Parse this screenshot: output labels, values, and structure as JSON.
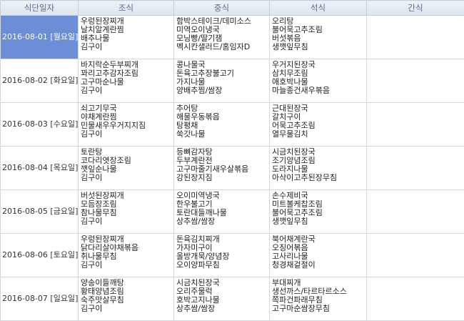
{
  "headers": [
    "식단일자",
    "조식",
    "중식",
    "석식",
    "간식"
  ],
  "rows": [
    {
      "date": "2016-08-01 [월요일]",
      "breakfast": [
        "우렁된장찌개",
        "날치알계란찜",
        "배추나물",
        "김구이"
      ],
      "lunch": [
        "함박스테이크/데미소스",
        "미역오이냉국",
        "모닝빵/딸기잼",
        "멕시칸샐러드/홈임자D"
      ],
      "dinner": [
        "오리탕",
        "불어묵고추조림",
        "버섯볶음",
        "생깻잎무침"
      ],
      "snack": []
    },
    {
      "date": "2016-08-02 [화요일]",
      "breakfast": [
        "바지락순두부찌개",
        "꽈리고추감자조림",
        "고구마순나물",
        "김구이"
      ],
      "lunch": [
        "콩나물국",
        "돈육고추장불고기",
        "가지나물",
        "양배추찜/쌈장"
      ],
      "dinner": [
        "우거지된장국",
        "삼치무조림",
        "애호박나물",
        "마늘종건새우볶음"
      ],
      "snack": []
    },
    {
      "date": "2016-08-03 [수요일]",
      "breakfast": [
        "쇠고기무국",
        "야채계란찜",
        "민물새우우거지지짐",
        "김구이"
      ],
      "lunch": [
        "추어탕",
        "해물우동볶음",
        "탕평채",
        "쑥갓나물"
      ],
      "dinner": [
        "근대된장국",
        "갈치구이",
        "어묵고추조림",
        "열무물김치"
      ],
      "snack": []
    },
    {
      "date": "2016-08-04 [목요일]",
      "breakfast": [
        "토란탕",
        "코다리엿장조림",
        "깻잎순나물",
        "김구이"
      ],
      "lunch": [
        "등뼈감자탕",
        "두부계란전",
        "고구마줄기새우살볶음",
        "강된장지짐"
      ],
      "dinner": [
        "시금치된장국",
        "조기양념조림",
        "도라지나물",
        "아삭이고추된장무침"
      ],
      "snack": []
    },
    {
      "date": "2016-08-05 [금요일]",
      "breakfast": [
        "버섯된장찌개",
        "모듬장조림",
        "참나물무침",
        "김구이"
      ],
      "lunch": [
        "오이미역냉국",
        "한우불고기",
        "토란대들깨나물",
        "상추쌈/쌈장"
      ],
      "dinner": [
        "손수제비국",
        "미트볼케찹조림",
        "불어묵고추조림",
        "생깻잎무침"
      ],
      "snack": []
    },
    {
      "date": "2016-08-06 [토요일]",
      "breakfast": [
        "우렁된장찌개",
        "닭다리살야채볶음",
        "취나물무침",
        "김구이"
      ],
      "lunch": [
        "돈육김치찌개",
        "가자미구이",
        "올방개묵/양념장",
        "오이양파무침"
      ],
      "dinner": [
        "북어채계란국",
        "오징어볶음",
        "고사리나물",
        "청경채겉절이"
      ],
      "snack": []
    },
    {
      "date": "2016-08-07 [일요일]",
      "breakfast": [
        "양송이들깨탕",
        "황태양념조림",
        "숙주맛살무침",
        "김구이"
      ],
      "lunch": [
        "시금치된장국",
        "오리주물럭",
        "호박고지나물",
        "상추쌈/쌈장"
      ],
      "dinner": [
        "부대찌개",
        "생선까스/타르타르소스",
        "쪽파건파래무침",
        "고구마순쌈장무침"
      ],
      "snack": []
    }
  ],
  "selected_row": 0
}
